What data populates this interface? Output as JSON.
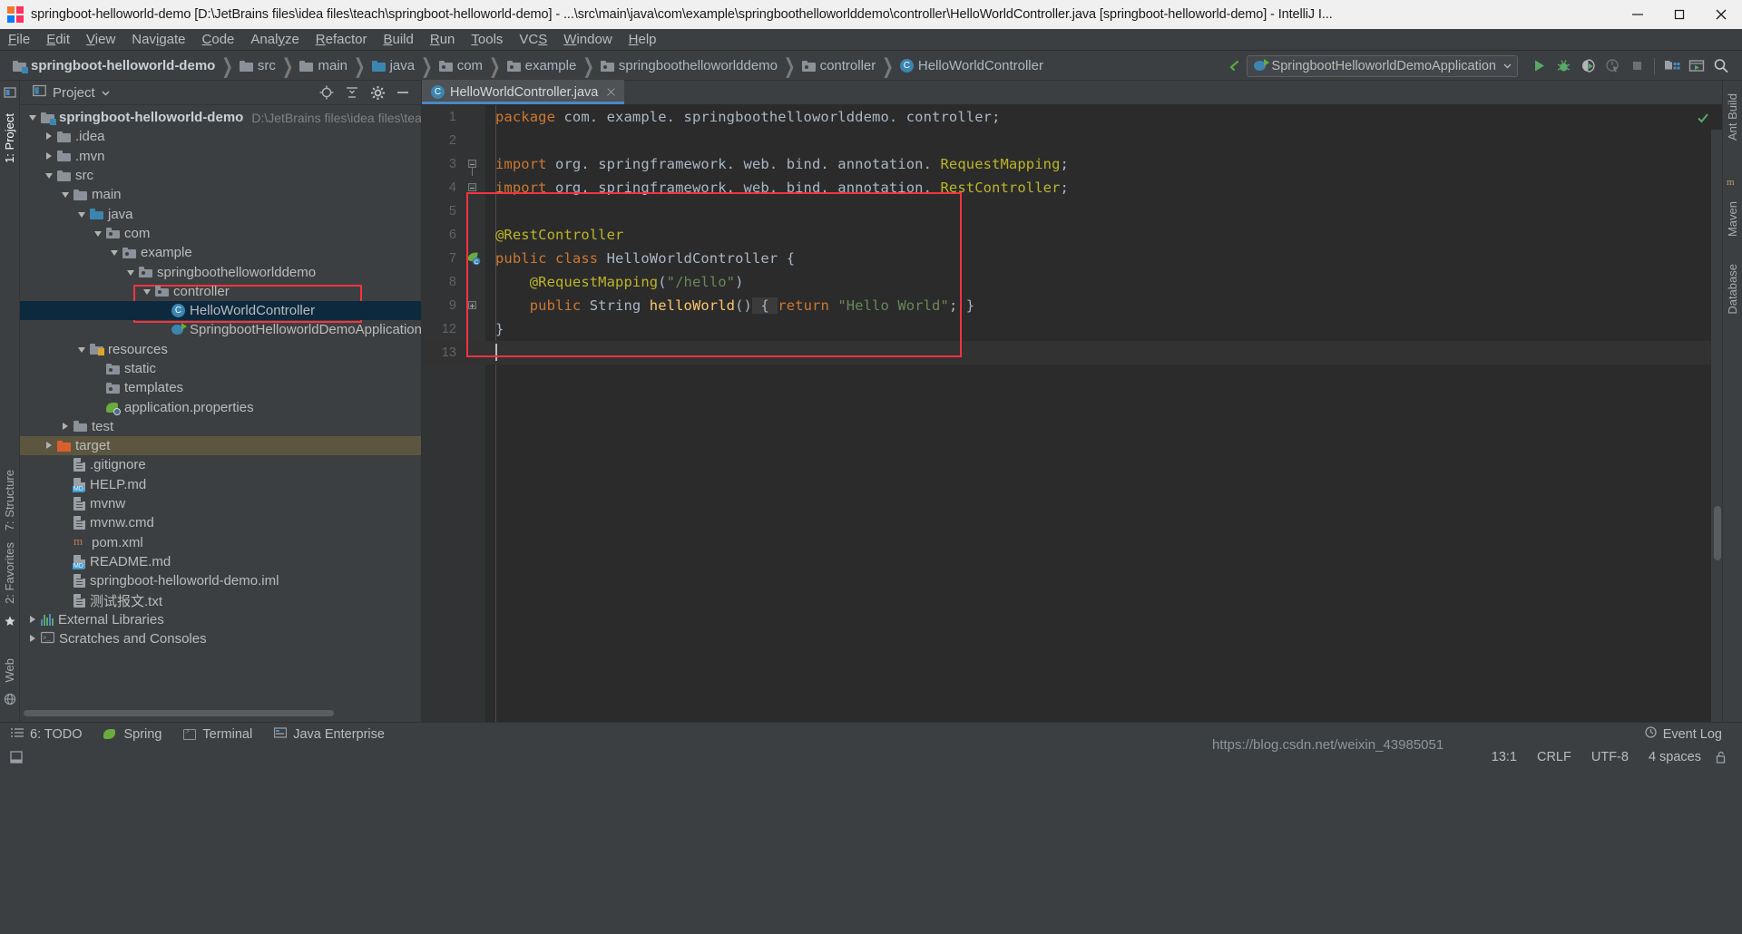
{
  "window": {
    "title": "springboot-helloworld-demo [D:\\JetBrains files\\idea files\\teach\\springboot-helloworld-demo] - ...\\src\\main\\java\\com\\example\\springboothelloworlddemo\\controller\\HelloWorldController.java [springboot-helloworld-demo] - IntelliJ I...",
    "app_icon": "intellij-idea-icon",
    "minimize": "minimize-button",
    "maximize": "maximize-button",
    "close": "close-button"
  },
  "menubar": {
    "items": [
      {
        "label": "File"
      },
      {
        "label": "Edit"
      },
      {
        "label": "View"
      },
      {
        "label": "Navigate"
      },
      {
        "label": "Code"
      },
      {
        "label": "Analyze"
      },
      {
        "label": "Refactor"
      },
      {
        "label": "Build"
      },
      {
        "label": "Run"
      },
      {
        "label": "Tools"
      },
      {
        "label": "VCS"
      },
      {
        "label": "Window"
      },
      {
        "label": "Help"
      }
    ]
  },
  "breadcrumb": {
    "items": [
      {
        "label": "springboot-helloworld-demo",
        "icon": "project-folder-icon",
        "kind": "root"
      },
      {
        "label": "src",
        "icon": "folder-icon",
        "kind": "folder"
      },
      {
        "label": "main",
        "icon": "folder-icon",
        "kind": "folder"
      },
      {
        "label": "java",
        "icon": "source-folder-icon",
        "kind": "source"
      },
      {
        "label": "com",
        "icon": "package-icon",
        "kind": "package"
      },
      {
        "label": "example",
        "icon": "package-icon",
        "kind": "package"
      },
      {
        "label": "springboothelloworlddemo",
        "icon": "package-icon",
        "kind": "package"
      },
      {
        "label": "controller",
        "icon": "package-icon",
        "kind": "package"
      },
      {
        "label": "HelloWorldController",
        "icon": "java-class-icon",
        "kind": "class"
      }
    ]
  },
  "toolbar": {
    "back_icon": "back-arrow-icon",
    "run_config": {
      "label": "SpringbootHelloworldDemoApplication",
      "icon": "spring-boot-icon",
      "chevron": "chevron-down-icon"
    },
    "buttons": [
      {
        "name": "run-button",
        "icon": "run-icon",
        "label": "Run"
      },
      {
        "name": "debug-button",
        "icon": "debug-bug-icon",
        "label": "Debug"
      },
      {
        "name": "run-with-coverage-button",
        "icon": "coverage-icon",
        "label": "Run with Coverage"
      },
      {
        "name": "profile-button",
        "icon": "profiler-icon",
        "label": "Profile"
      },
      {
        "name": "stop-button",
        "icon": "stop-square-icon",
        "label": "Stop"
      },
      {
        "name": "project-structure-button",
        "icon": "project-structure-icon",
        "label": "Project Structure"
      },
      {
        "name": "update-app-button",
        "icon": "update-running-app-icon",
        "label": "Update Application"
      },
      {
        "name": "search-everywhere-button",
        "icon": "search-icon",
        "label": "Search Everywhere"
      }
    ]
  },
  "left_strip": {
    "tabs": [
      {
        "label": "1: Project",
        "active": true
      },
      {
        "label": "7: Structure",
        "active": false
      },
      {
        "label": "2: Favorites",
        "active": false
      },
      {
        "label": "Web",
        "active": false
      }
    ],
    "icons": [
      "project-tool-icon",
      "star-icon",
      "web-icon"
    ]
  },
  "right_strip": {
    "tabs": [
      {
        "label": "Ant Build"
      },
      {
        "label": "Maven"
      },
      {
        "label": "Database"
      }
    ]
  },
  "project_panel": {
    "title": "Project",
    "title_icon": "project-view-icon",
    "chevron": "chevron-down-icon",
    "actions": [
      {
        "name": "scroll-from-source-button",
        "icon": "target-crosshair-icon"
      },
      {
        "name": "collapse-all-button",
        "icon": "collapse-all-icon"
      },
      {
        "name": "settings-button",
        "icon": "gear-icon"
      },
      {
        "name": "hide-button",
        "icon": "minus-icon"
      }
    ],
    "tree": [
      {
        "label": "springboot-helloworld-demo",
        "path": "D:\\JetBrains files\\idea files\\teach\\spri",
        "indent": 0,
        "twisty": "expanded",
        "icon": "project-folder-icon",
        "bold": true,
        "state": "normal"
      },
      {
        "label": ".idea",
        "indent": 1,
        "twisty": "collapsed",
        "icon": "folder-icon",
        "state": "normal"
      },
      {
        "label": ".mvn",
        "indent": 1,
        "twisty": "collapsed",
        "icon": "folder-icon",
        "state": "normal"
      },
      {
        "label": "src",
        "indent": 1,
        "twisty": "expanded",
        "icon": "folder-icon",
        "state": "normal"
      },
      {
        "label": "main",
        "indent": 2,
        "twisty": "expanded",
        "icon": "folder-icon",
        "state": "normal"
      },
      {
        "label": "java",
        "indent": 3,
        "twisty": "expanded",
        "icon": "source-folder-icon",
        "state": "normal"
      },
      {
        "label": "com",
        "indent": 4,
        "twisty": "expanded",
        "icon": "package-icon",
        "state": "normal"
      },
      {
        "label": "example",
        "indent": 5,
        "twisty": "expanded",
        "icon": "package-icon",
        "state": "normal"
      },
      {
        "label": "springboothelloworlddemo",
        "indent": 6,
        "twisty": "expanded",
        "icon": "package-icon",
        "state": "normal"
      },
      {
        "label": "controller",
        "indent": 7,
        "twisty": "expanded",
        "icon": "package-icon",
        "state": "normal"
      },
      {
        "label": "HelloWorldController",
        "indent": 8,
        "twisty": "none",
        "icon": "java-class-icon",
        "state": "selected"
      },
      {
        "label": "SpringbootHelloworldDemoApplication",
        "indent": 8,
        "twisty": "none",
        "icon": "spring-boot-class-icon",
        "state": "normal"
      },
      {
        "label": "resources",
        "indent": 3,
        "twisty": "expanded",
        "icon": "resources-folder-icon",
        "state": "normal"
      },
      {
        "label": "static",
        "indent": 4,
        "twisty": "none",
        "icon": "package-icon",
        "state": "normal"
      },
      {
        "label": "templates",
        "indent": 4,
        "twisty": "none",
        "icon": "package-icon",
        "state": "normal"
      },
      {
        "label": "application.properties",
        "indent": 4,
        "twisty": "none",
        "icon": "spring-properties-icon",
        "state": "normal"
      },
      {
        "label": "test",
        "indent": 2,
        "twisty": "collapsed",
        "icon": "folder-icon",
        "state": "normal"
      },
      {
        "label": "target",
        "indent": 1,
        "twisty": "collapsed",
        "icon": "target-folder-icon",
        "state": "highlighted"
      },
      {
        "label": ".gitignore",
        "indent": 2,
        "twisty": "none",
        "icon": "file-icon",
        "state": "normal"
      },
      {
        "label": "HELP.md",
        "indent": 2,
        "twisty": "none",
        "icon": "markdown-file-icon",
        "state": "normal"
      },
      {
        "label": "mvnw",
        "indent": 2,
        "twisty": "none",
        "icon": "file-icon",
        "state": "normal"
      },
      {
        "label": "mvnw.cmd",
        "indent": 2,
        "twisty": "none",
        "icon": "file-icon",
        "state": "normal"
      },
      {
        "label": "pom.xml",
        "indent": 2,
        "twisty": "none",
        "icon": "maven-pom-icon",
        "state": "normal"
      },
      {
        "label": "README.md",
        "indent": 2,
        "twisty": "none",
        "icon": "markdown-file-icon",
        "state": "normal"
      },
      {
        "label": "springboot-helloworld-demo.iml",
        "indent": 2,
        "twisty": "none",
        "icon": "file-icon",
        "state": "normal"
      },
      {
        "label": "测试报文.txt",
        "indent": 2,
        "twisty": "none",
        "icon": "text-file-icon",
        "state": "normal"
      },
      {
        "label": "External Libraries",
        "indent": 0,
        "twisty": "collapsed",
        "icon": "libraries-icon",
        "state": "normal"
      },
      {
        "label": "Scratches and Consoles",
        "indent": 0,
        "twisty": "collapsed",
        "icon": "scratches-icon",
        "state": "normal"
      }
    ]
  },
  "editor": {
    "tab": {
      "label": "HelloWorldController.java",
      "icon": "java-class-icon",
      "close_icon": "close-icon"
    },
    "inspection_status_icon": "inspections-ok-checkmark",
    "gutter_run_icon": "spring-bean-gutter-icon",
    "lines": [
      {
        "num": "1",
        "tokens": [
          {
            "t": "package ",
            "c": "kw"
          },
          {
            "t": "com. example. springboothelloworlddemo. controller",
            "c": "ident"
          },
          {
            "t": ";",
            "c": "punc"
          }
        ]
      },
      {
        "num": "2",
        "tokens": []
      },
      {
        "num": "3",
        "fold": "minus-top",
        "tokens": [
          {
            "t": "import ",
            "c": "kw"
          },
          {
            "t": "org. springframework. web. bind. annotation. ",
            "c": "ident"
          },
          {
            "t": "RequestMapping",
            "c": "anno"
          },
          {
            "t": ";",
            "c": "punc"
          }
        ]
      },
      {
        "num": "4",
        "fold": "minus-bottom",
        "tokens": [
          {
            "t": "import ",
            "c": "kw"
          },
          {
            "t": "org. springframework. web. bind. annotation. ",
            "c": "ident"
          },
          {
            "t": "RestController",
            "c": "anno"
          },
          {
            "t": ";",
            "c": "punc"
          }
        ]
      },
      {
        "num": "5",
        "tokens": []
      },
      {
        "num": "6",
        "tokens": [
          {
            "t": "@RestController",
            "c": "anno"
          }
        ]
      },
      {
        "num": "7",
        "gutter_icon": "spring-bean-gutter-icon",
        "tokens": [
          {
            "t": "public class ",
            "c": "kw"
          },
          {
            "t": "HelloWorldController ",
            "c": "cls"
          },
          {
            "t": "{",
            "c": "punc"
          }
        ]
      },
      {
        "num": "8",
        "tokens": [
          {
            "t": "    @RequestMapping",
            "c": "anno"
          },
          {
            "t": "(",
            "c": "punc"
          },
          {
            "t": "\"/hello\"",
            "c": "str"
          },
          {
            "t": ")",
            "c": "punc"
          }
        ]
      },
      {
        "num": "9",
        "fold": "plus",
        "tokens": [
          {
            "t": "    public ",
            "c": "kw"
          },
          {
            "t": "String ",
            "c": "cls"
          },
          {
            "t": "helloWorld",
            "c": "method"
          },
          {
            "t": "()",
            "c": "punc"
          },
          {
            "t": " { ",
            "c": "hint"
          },
          {
            "t": "return ",
            "c": "kw"
          },
          {
            "t": "\"Hello World\"",
            "c": "str"
          },
          {
            "t": "; }",
            "c": "punc"
          }
        ]
      },
      {
        "num": "12",
        "tokens": [
          {
            "t": "}",
            "c": "punc"
          }
        ]
      },
      {
        "num": "13",
        "caret": true,
        "tokens": []
      }
    ]
  },
  "annotations": {
    "tree_rect": {
      "color": "#f5333f"
    },
    "code_rect": {
      "color": "#f5333f"
    }
  },
  "bottom_bar": {
    "items": [
      {
        "label": "6: TODO",
        "icon": "todo-list-icon",
        "mnemonic": "6"
      },
      {
        "label": "Spring",
        "icon": "spring-leaf-icon"
      },
      {
        "label": "Terminal",
        "icon": "terminal-icon"
      },
      {
        "label": "Java Enterprise",
        "icon": "java-enterprise-icon"
      }
    ],
    "event_log": {
      "label": "Event Log",
      "icon": "event-log-icon"
    }
  },
  "status_bar": {
    "left_icon": "show-toolbar-icon",
    "caret_position": "13:1",
    "line_separator": "CRLF",
    "encoding": "UTF-8",
    "indent": "4 spaces",
    "lock_icon": "unlocked-icon"
  },
  "watermark": {
    "text": "https://blog.csdn.net/weixin_43985051"
  },
  "colors": {
    "accent_blue": "#4a88c7",
    "selection": "#0d293e",
    "highlight_row": "#5c5640",
    "annotation_red": "#f5333f",
    "editor_bg": "#2b2b2b",
    "panel_bg": "#3c3f41",
    "keyword_orange": "#cc7832",
    "annotation_yellow": "#bbb529",
    "string_green": "#6a8759",
    "method_yellow": "#ffc66d",
    "identifier": "#a9b7c6"
  }
}
